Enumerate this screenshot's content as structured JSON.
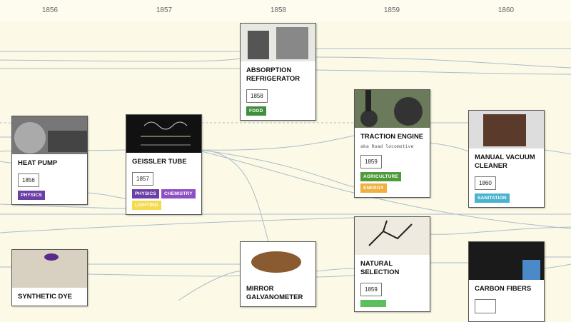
{
  "years": [
    "1856",
    "1857",
    "1858",
    "1859",
    "1860"
  ],
  "tag_colors": {
    "physics": "#6a3fa6",
    "chemistry": "#8e4fc4",
    "lighting": "#f5d94e",
    "food": "#3f8f3f",
    "agriculture": "#4f9a3a",
    "energy": "#f0b040",
    "sanitation": "#4ab3cf",
    "biology": "#5cc05c"
  },
  "cards": [
    {
      "title": "Absorption Refrigerator",
      "year": "1858",
      "tags": [
        "Food"
      ]
    },
    {
      "title": "Heat Pump",
      "year": "1856",
      "tags": [
        "Physics"
      ]
    },
    {
      "title": "Geissler Tube",
      "year": "1857",
      "tags": [
        "Physics",
        "Chemistry",
        "Lighting"
      ]
    },
    {
      "title": "Traction Engine",
      "aka": "aka Road locomotive",
      "year": "1859",
      "tags": [
        "Agriculture",
        "Energy"
      ]
    },
    {
      "title": "Manual Vacuum Cleaner",
      "year": "1860",
      "tags": [
        "Sanitation"
      ]
    },
    {
      "title": "Synthetic Dye"
    },
    {
      "title": "Mirror Galvanometer"
    },
    {
      "title": "Natural Selection",
      "year": "1859"
    },
    {
      "title": "Carbon Fibers"
    }
  ]
}
